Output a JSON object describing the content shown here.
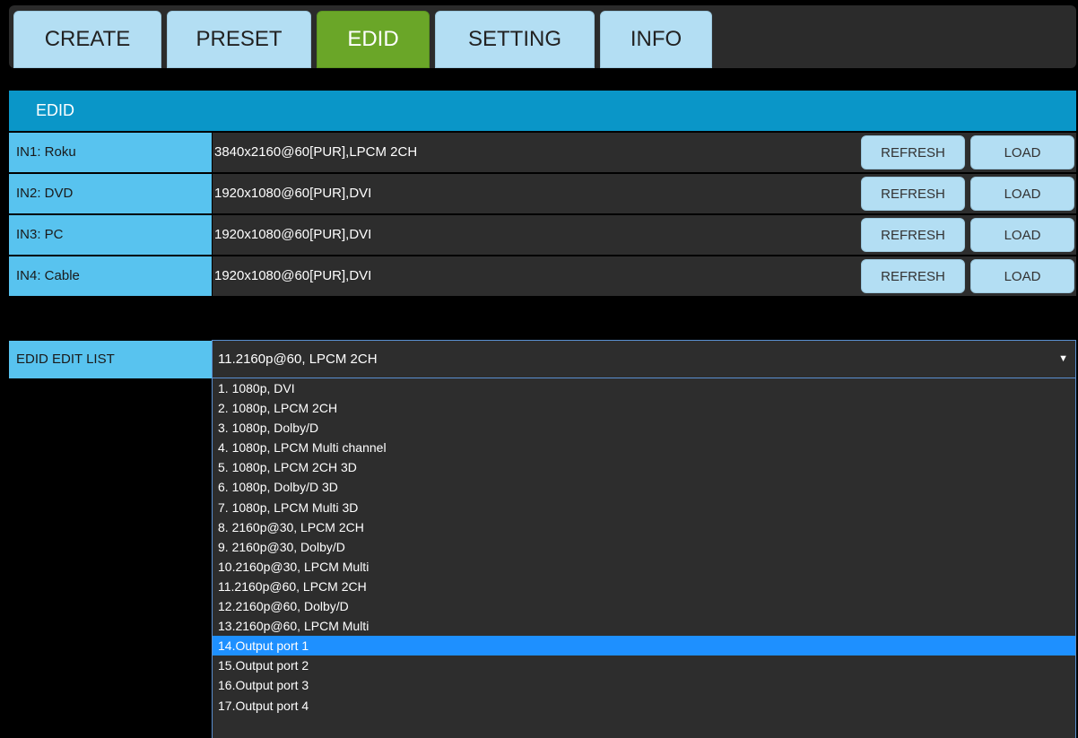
{
  "tabs": [
    {
      "label": "CREATE",
      "active": false
    },
    {
      "label": "PRESET",
      "active": false
    },
    {
      "label": "EDID",
      "active": true
    },
    {
      "label": "SETTING",
      "active": false
    },
    {
      "label": "INFO",
      "active": false
    }
  ],
  "section": {
    "title": "EDID"
  },
  "inputs": [
    {
      "label": "IN1: Roku",
      "value": "3840x2160@60[PUR],LPCM 2CH",
      "refresh": "REFRESH",
      "load": "LOAD"
    },
    {
      "label": "IN2: DVD",
      "value": "1920x1080@60[PUR],DVI",
      "refresh": "REFRESH",
      "load": "LOAD"
    },
    {
      "label": "IN3: PC",
      "value": "1920x1080@60[PUR],DVI",
      "refresh": "REFRESH",
      "load": "LOAD"
    },
    {
      "label": "IN4: Cable",
      "value": "1920x1080@60[PUR],DVI",
      "refresh": "REFRESH",
      "load": "LOAD"
    }
  ],
  "edit_list": {
    "label": "EDID EDIT LIST",
    "selected": "11.2160p@60, LPCM 2CH",
    "arrow": "▼",
    "options": [
      "1. 1080p, DVI",
      "2. 1080p, LPCM 2CH",
      "3. 1080p, Dolby/D",
      "4. 1080p, LPCM Multi channel",
      "5. 1080p, LPCM 2CH 3D",
      "6. 1080p, Dolby/D 3D",
      "7. 1080p, LPCM Multi 3D",
      "8. 2160p@30, LPCM 2CH",
      "9. 2160p@30, Dolby/D",
      "10.2160p@30, LPCM Multi",
      "11.2160p@60, LPCM 2CH",
      "12.2160p@60, Dolby/D",
      "13.2160p@60, LPCM Multi",
      "14.Output port 1",
      "15.Output port 2",
      "16.Output port 3",
      "17.Output port 4"
    ],
    "highlighted": "14.Output port 1"
  },
  "colors": {
    "active_tab": "#6aa628",
    "tab": "#b3def3",
    "header": "#0a96c8",
    "label_bg": "#58c3ef",
    "highlight": "#1e90ff"
  }
}
